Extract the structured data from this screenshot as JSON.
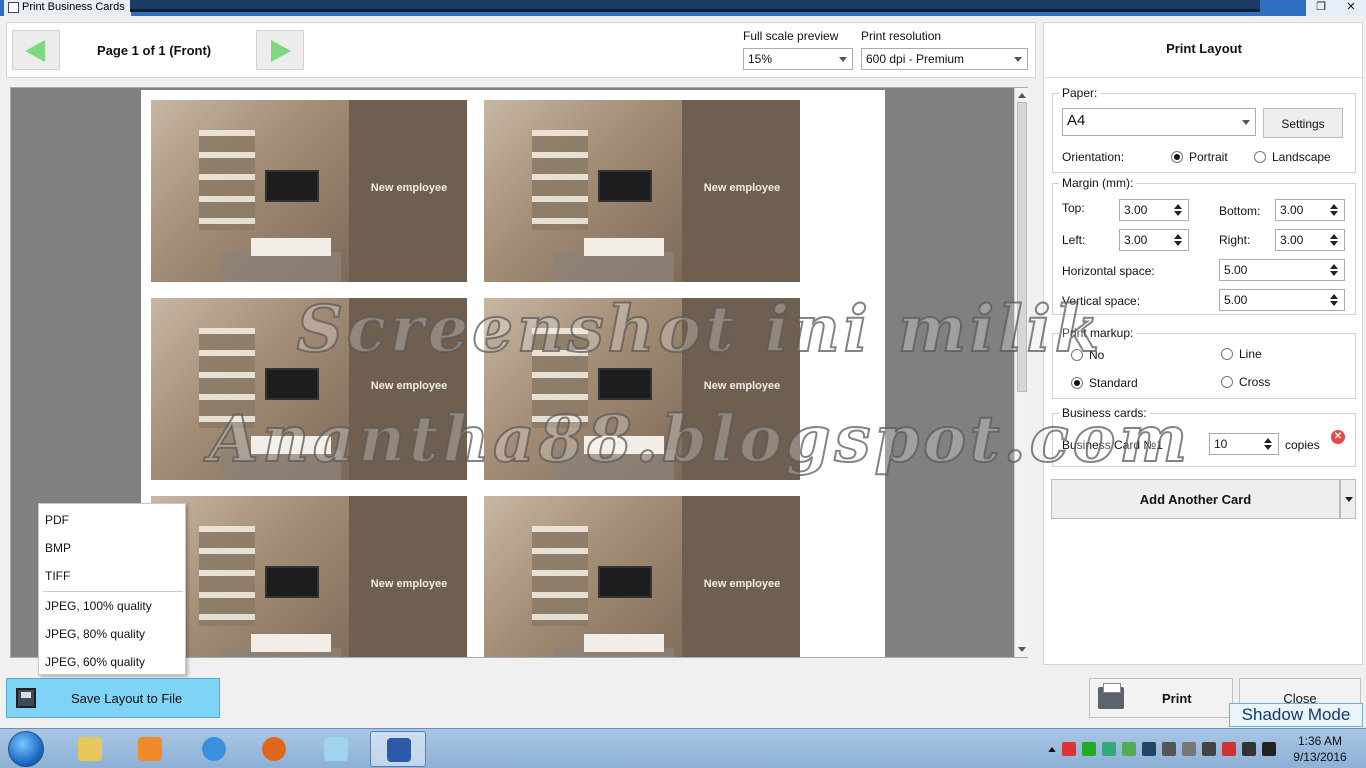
{
  "window": {
    "title": "Print Business Cards"
  },
  "preview": {
    "page_label": "Page 1 of 1 (Front)",
    "full_scale_label": "Full scale preview",
    "full_scale_value": "15%",
    "resolution_label": "Print resolution",
    "resolution_value": "600 dpi - Premium",
    "card_text": "New employee"
  },
  "export_menu": {
    "items": [
      "PDF",
      "BMP",
      "TIFF",
      "JPEG, 100% quality",
      "JPEG, 80% quality",
      "JPEG, 60% quality"
    ]
  },
  "save_button": "Save Layout to File",
  "print_layout": {
    "title": "Print Layout",
    "paper_label": "Paper:",
    "paper_value": "A4",
    "settings_button": "Settings",
    "orientation_label": "Orientation:",
    "orientation_portrait": "Portrait",
    "orientation_landscape": "Landscape",
    "orientation_selected": "Portrait",
    "margin_label": "Margin (mm):",
    "top_label": "Top:",
    "top_value": "3.00",
    "bottom_label": "Bottom:",
    "bottom_value": "3.00",
    "left_label": "Left:",
    "left_value": "3.00",
    "right_label": "Right:",
    "right_value": "3.00",
    "hspace_label": "Horizontal space:",
    "hspace_value": "5.00",
    "vspace_label": "Vertical space:",
    "vspace_value": "5.00",
    "markup_label": "Print markup:",
    "markup_no": "No",
    "markup_line": "Line",
    "markup_standard": "Standard",
    "markup_cross": "Cross",
    "markup_selected": "Standard",
    "cards_label": "Business cards:",
    "card_name": "Business Card №1",
    "card_copies": "10",
    "copies_label": "copies",
    "add_card_button": "Add Another Card"
  },
  "print_button": "Print",
  "close_button": "Close",
  "shadow_mode": "Shadow Mode",
  "watermark": [
    "Screenshot ini milik",
    "Anantha88.blogspot.com"
  ],
  "taskbar": {
    "apps": [
      "start-orb",
      "file-explorer",
      "media-player",
      "internet-explorer",
      "firefox",
      "notepad",
      "print-business-cards"
    ],
    "time": "1:36 AM",
    "date": "9/13/2016"
  }
}
